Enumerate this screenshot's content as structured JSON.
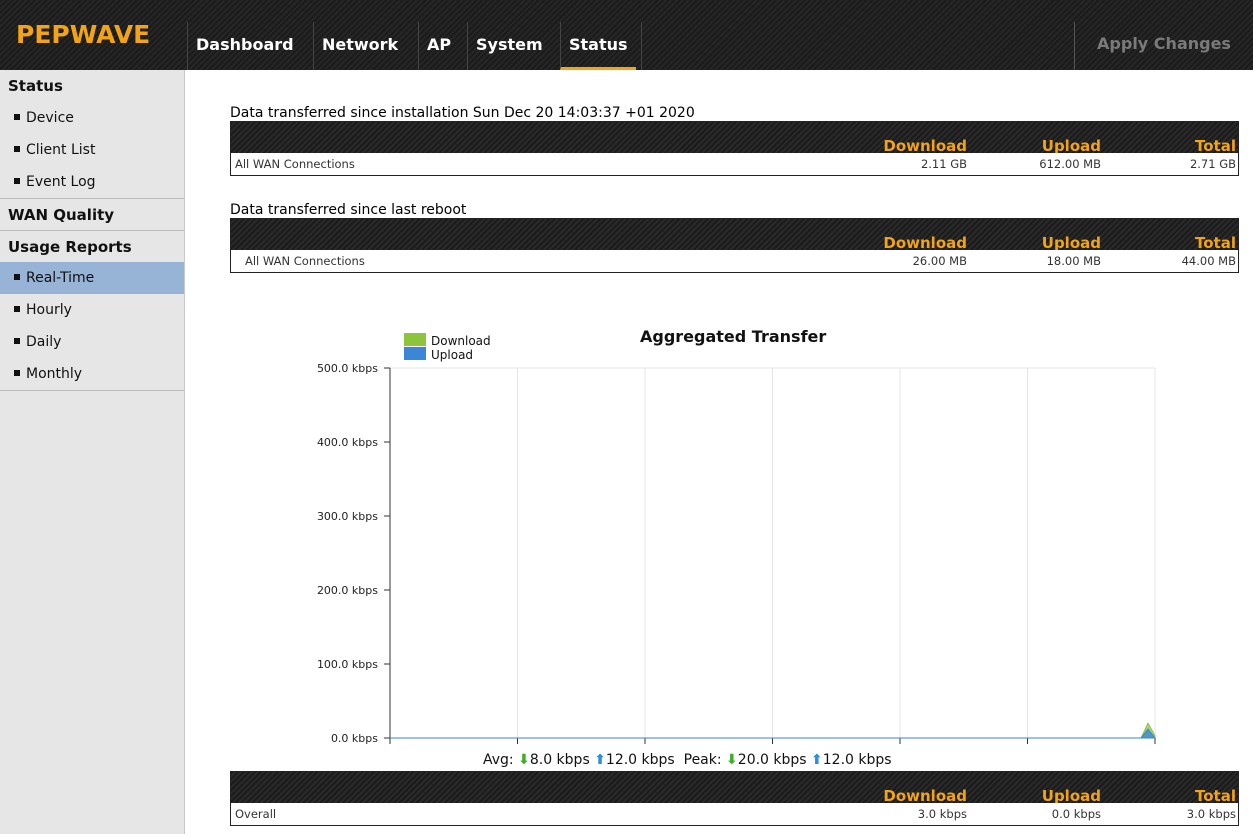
{
  "header": {
    "logo": "PEPWAVE",
    "tabs": [
      {
        "label": "Dashboard"
      },
      {
        "label": "Network"
      },
      {
        "label": "AP"
      },
      {
        "label": "System"
      },
      {
        "label": "Status"
      }
    ],
    "active_tab": "Status",
    "apply_label": "Apply Changes",
    "accent_color": "#f3a316"
  },
  "sidebar": {
    "sections": [
      {
        "title": "Status",
        "items": [
          "Device",
          "Client List",
          "Event Log"
        ]
      },
      {
        "title": "WAN Quality",
        "items": []
      },
      {
        "title": "Usage Reports",
        "items": [
          "Real-Time",
          "Hourly",
          "Daily",
          "Monthly"
        ]
      }
    ],
    "active_item": "Real-Time",
    "active_color": "#97b3d6"
  },
  "tables": {
    "install": {
      "title": "Data transferred since installation Sun Dec 20 14:03:37 +01 2020",
      "headers": {
        "download": "Download",
        "upload": "Upload",
        "total": "Total"
      },
      "row": {
        "label": "All WAN Connections",
        "download": "2.11 GB",
        "upload": "612.00 MB",
        "total": "2.71 GB"
      }
    },
    "reboot": {
      "title": "Data transferred since last reboot",
      "headers": {
        "download": "Download",
        "upload": "Upload",
        "total": "Total"
      },
      "row": {
        "label": "All WAN Connections",
        "download": "26.00 MB",
        "upload": "18.00 MB",
        "total": "44.00 MB"
      }
    },
    "overall": {
      "headers": {
        "download": "Download",
        "upload": "Upload",
        "total": "Total"
      },
      "row": {
        "label": "Overall",
        "download": "3.0 kbps",
        "upload": "0.0 kbps",
        "total": "3.0 kbps"
      }
    }
  },
  "chart_data": {
    "type": "area",
    "title": "Aggregated Transfer",
    "xlabel": "",
    "ylabel": "",
    "ylim": [
      0,
      500
    ],
    "yticks": [
      "0.0 kbps",
      "100.0 kbps",
      "200.0 kbps",
      "300.0 kbps",
      "400.0 kbps",
      "500.0 kbps"
    ],
    "ytick_values": [
      0,
      100,
      200,
      300,
      400,
      500
    ],
    "x_divisions": 6,
    "grid": true,
    "legend_position": "top-left",
    "series": [
      {
        "name": "Download",
        "color": "#8cc43c",
        "values": [
          0,
          0,
          0,
          0,
          0,
          0,
          0,
          0,
          0,
          0,
          20,
          3
        ]
      },
      {
        "name": "Upload",
        "color": "#3b86d6",
        "values": [
          0,
          0,
          0,
          0,
          0,
          0,
          0,
          0,
          0,
          0,
          12,
          0
        ]
      }
    ]
  },
  "summary": {
    "avg_label": "Avg:",
    "avg_download": "8.0 kbps",
    "avg_upload": "12.0 kbps",
    "peak_label": "Peak:",
    "peak_download": "20.0 kbps",
    "peak_upload": "12.0 kbps"
  }
}
